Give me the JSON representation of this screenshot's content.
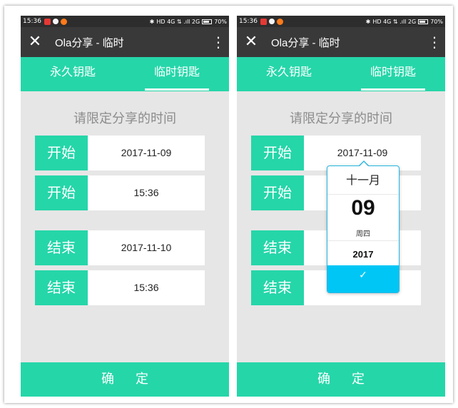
{
  "status": {
    "time": "15:36",
    "signal": "HD 4G ⇅ .ıll 2G",
    "battery": "70%"
  },
  "titlebar": {
    "close_icon": "close-icon",
    "title": "Ola分享 - 临时",
    "more_icon": "more-vert-icon"
  },
  "tabs": [
    {
      "label": "永久钥匙",
      "active": false
    },
    {
      "label": "临时钥匙",
      "active": true
    }
  ],
  "heading": "请限定分享的时间",
  "rows": [
    {
      "label": "开始",
      "value": "2017-11-09"
    },
    {
      "label": "开始",
      "value": "15:36"
    },
    {
      "label": "结束",
      "value": "2017-11-10"
    },
    {
      "label": "结束",
      "value": "15:36"
    }
  ],
  "right_rows": [
    {
      "label": "开始",
      "value": "2017-11-09"
    },
    {
      "label": "开始",
      "value": ""
    },
    {
      "label": "结束",
      "value": ""
    },
    {
      "label": "结束",
      "value": ""
    }
  ],
  "picker": {
    "month": "十一月",
    "day": "09",
    "weekday": "周四",
    "year": "2017",
    "ok_glyph": "✓"
  },
  "confirm_label": "确定",
  "colors": {
    "accent": "#25d6a9",
    "titlebar": "#393939",
    "picker_ok": "#00c6f5"
  }
}
